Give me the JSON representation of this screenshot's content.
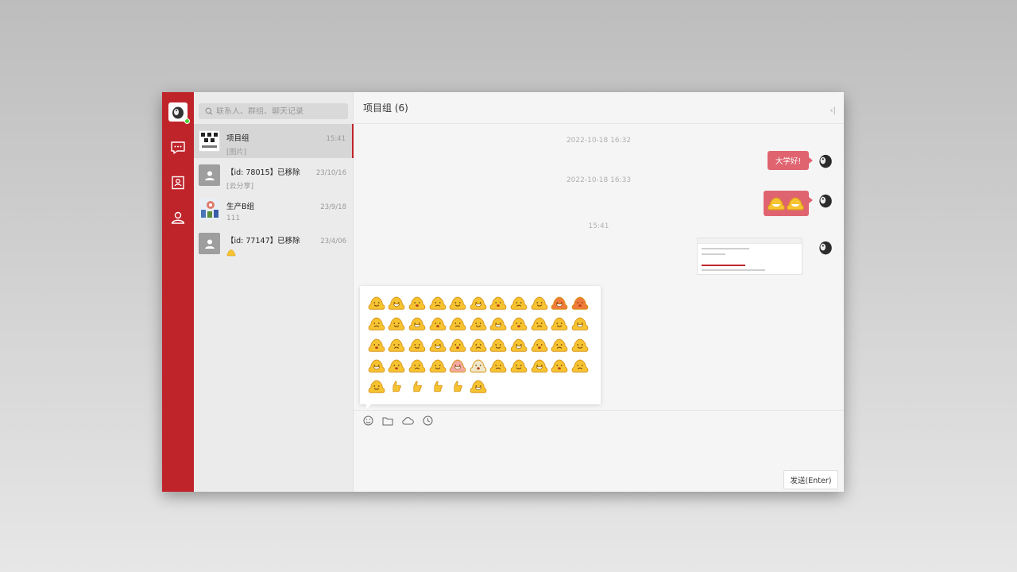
{
  "search": {
    "placeholder": "联系人、群组、聊天记录"
  },
  "conversations": [
    {
      "name": "项目组",
      "preview": "[图片]",
      "time": "15:41",
      "avatar": "grid-icon"
    },
    {
      "name": "【id: 78015】已移除",
      "preview": "[云分享]",
      "time": "23/10/16",
      "avatar": "default-user-icon"
    },
    {
      "name": "生产B组",
      "preview": "111",
      "time": "23/9/18",
      "avatar": "group-photo"
    },
    {
      "name": "【id: 77147】已移除",
      "preview": "",
      "time": "23/4/06",
      "avatar": "default-user-icon"
    }
  ],
  "chat": {
    "title": "项目组 (6)",
    "timestamps": [
      "2022-10-18 16:32",
      "2022-10-18 16:33",
      "15:41"
    ],
    "messages": [
      {
        "type": "text",
        "text": "大学好!"
      },
      {
        "type": "emoji",
        "emoji_count": 2
      },
      {
        "type": "image"
      }
    ]
  },
  "emoji_panel": {
    "count": 50,
    "colors": {
      "face": "#f7c431",
      "outline": "#d9961a"
    }
  },
  "composer": {
    "send_label": "发送(Enter)"
  },
  "colors": {
    "accent": "#c0242b",
    "bubble": "#e06470"
  }
}
